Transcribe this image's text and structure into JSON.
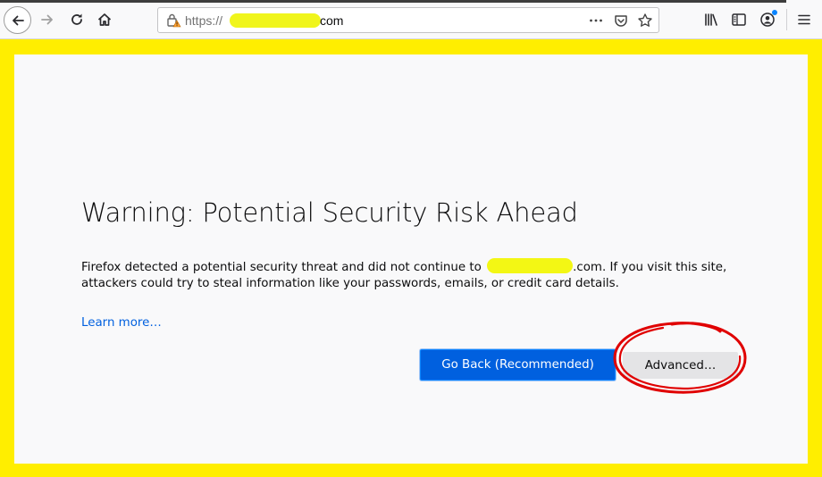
{
  "browser": {
    "url_prefix": "https://",
    "url_suffix": "com"
  },
  "error_page": {
    "title": "Warning: Potential Security Risk Ahead",
    "description_before": "Firefox detected a potential security threat and did not continue to ",
    "description_after": ".com. If you visit this site, attackers could try to steal information like your passwords, emails, or credit card details.",
    "learn_more": "Learn more…",
    "go_back_label": "Go Back (Recommended)",
    "advanced_label": "Advanced…"
  },
  "icons": [
    "back-arrow-icon",
    "forward-arrow-icon",
    "reload-icon",
    "home-icon",
    "warning-lock-icon",
    "more-actions-icon",
    "pocket-icon",
    "bookmark-star-icon",
    "library-icon",
    "sidebar-icon",
    "account-icon",
    "hamburger-menu-icon"
  ],
  "colors": {
    "frame_highlight": "#ffee00",
    "primary_button": "#0060df",
    "link": "#0060df",
    "annotation_circle": "#e00000"
  }
}
